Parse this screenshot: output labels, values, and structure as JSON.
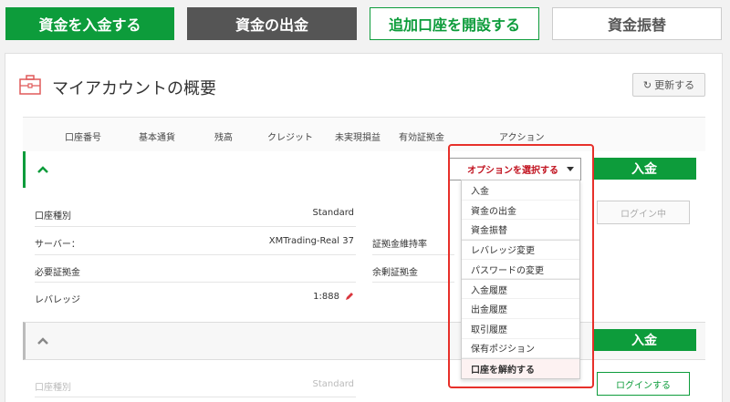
{
  "nav": {
    "deposit": "資金を入金する",
    "withdraw": "資金の出金",
    "open_account": "追加口座を開設する",
    "transfer": "資金振替"
  },
  "panel": {
    "title": "マイアカウントの概要",
    "refresh": "更新する"
  },
  "table": {
    "headers": [
      "口座番号",
      "基本通貨",
      "残高",
      "クレジット",
      "未実現損益",
      "有効証拠金",
      "アクション"
    ]
  },
  "account1": {
    "select_label": "オプションを選択する",
    "deposit_button": "入金",
    "details": {
      "account_type_label": "口座種別",
      "account_type_value": "Standard",
      "server_label": "サーバー：",
      "server_value": "XMTrading-Real 37",
      "margin_level_label": "証拠金維持率",
      "required_margin_label": "必要証拠金",
      "free_margin_label": "余剰証拠金",
      "leverage_label": "レバレッジ",
      "leverage_value": "1:888"
    },
    "login_button": "ログイン中"
  },
  "account2": {
    "deposit_button": "入金",
    "account_type_label": "口座種別",
    "account_type_value": "Standard",
    "login_button": "ログインする"
  },
  "dropdown": {
    "items": [
      "入金",
      "資金の出金",
      "資金振替",
      "レバレッジ変更",
      "パスワードの変更",
      "入金履歴",
      "出金履歴",
      "取引履歴",
      "保有ポジション",
      "口座を解約する"
    ]
  },
  "colors": {
    "brand_green": "#0d9c3b",
    "highlight_red": "#e7302a",
    "dark_button": "#555555"
  }
}
